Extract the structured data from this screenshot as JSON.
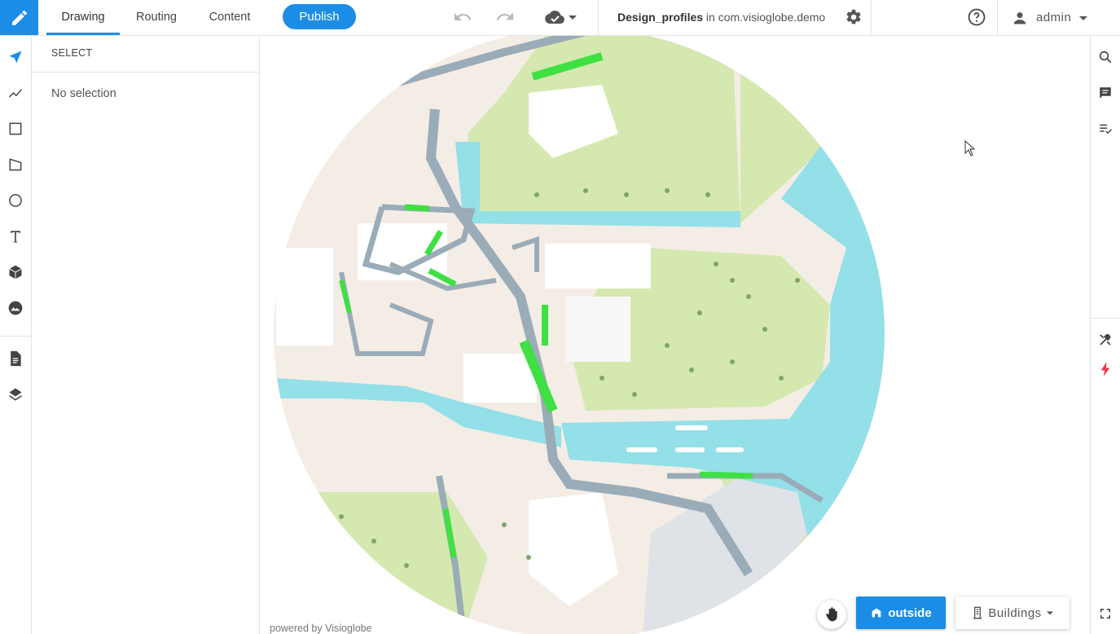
{
  "nav": {
    "tabs": [
      {
        "label": "Drawing",
        "active": true
      },
      {
        "label": "Routing",
        "active": false
      },
      {
        "label": "Content",
        "active": false
      }
    ],
    "publish_label": "Publish",
    "project_name": "Design_profiles",
    "project_context": " in com.visioglobe.demo",
    "user_name": "admin"
  },
  "panel": {
    "header": "SELECT",
    "empty_text": "No selection"
  },
  "map": {
    "credit": "powered by Visioglobe",
    "outside_label": "outside",
    "buildings_label": "Buildings"
  },
  "colors": {
    "accent": "#1b8de6",
    "water": "#93e0e8",
    "park": "#d5e8b0",
    "ground": "#f4ede6",
    "road": "#9aacb8",
    "highlight": "#3ee043",
    "alert": "#e8364a"
  },
  "icons": {
    "logo": "pencil-icon",
    "undo": "undo-icon",
    "redo": "redo-icon",
    "cloud": "cloud-check-icon",
    "settings": "gear-icon",
    "help": "help-icon",
    "user": "user-icon"
  }
}
